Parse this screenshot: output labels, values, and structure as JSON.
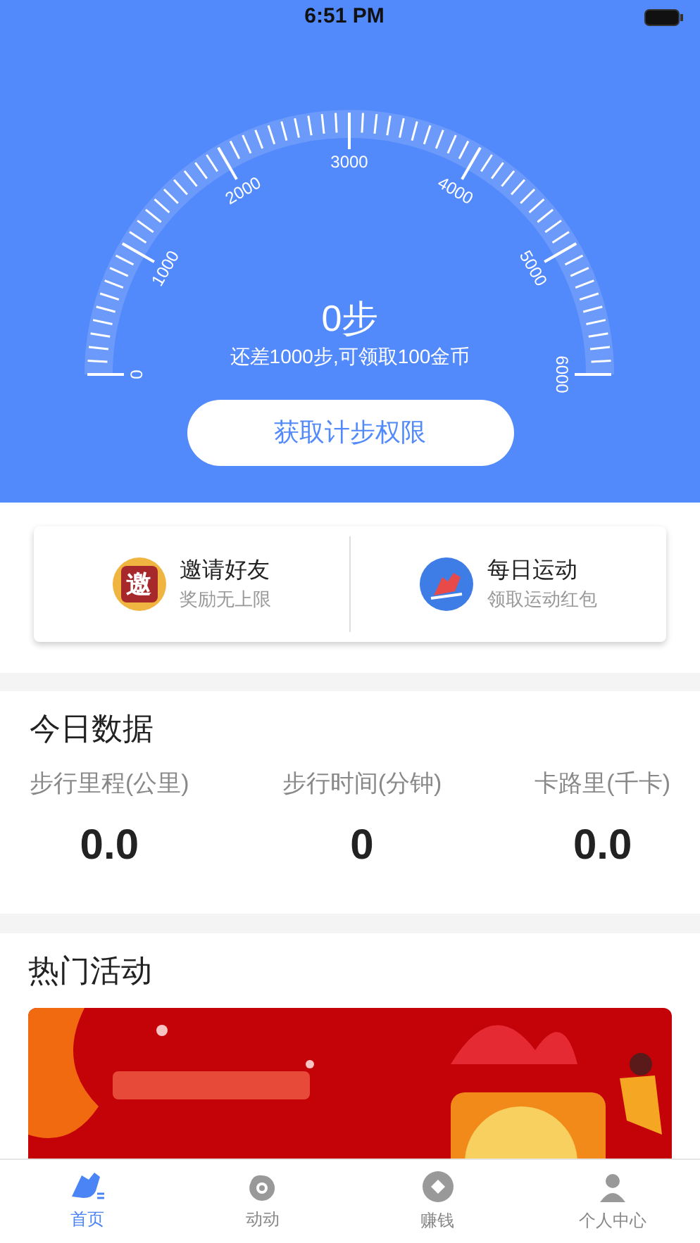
{
  "status_bar": {
    "time": "6:51 PM"
  },
  "gauge": {
    "scale_labels": [
      "0",
      "1000",
      "2000",
      "3000",
      "4000",
      "5000",
      "6000"
    ],
    "steps": "0步",
    "hint": "还差1000步,可领取100金币",
    "button": "获取计步权限"
  },
  "shortcuts": [
    {
      "kind": "invite",
      "badge": "邀",
      "title": "邀请好友",
      "subtitle": "奖励无上限"
    },
    {
      "kind": "sport",
      "title": "每日运动",
      "subtitle": "领取运动红包"
    }
  ],
  "today": {
    "title": "今日数据",
    "stats": [
      {
        "label": "步行里程(公里)",
        "value": "0.0"
      },
      {
        "label": "步行时间(分钟)",
        "value": "0"
      },
      {
        "label": "卡路里(千卡)",
        "value": "0.0"
      }
    ]
  },
  "activities": {
    "title": "热门活动"
  },
  "tab_bar": [
    {
      "kind": "shoe",
      "label": "首页",
      "selected": true
    },
    {
      "kind": "eye",
      "label": "动动",
      "selected": false
    },
    {
      "kind": "coin",
      "label": "赚钱",
      "selected": false
    },
    {
      "kind": "user",
      "label": "个人中心",
      "selected": false
    }
  ]
}
